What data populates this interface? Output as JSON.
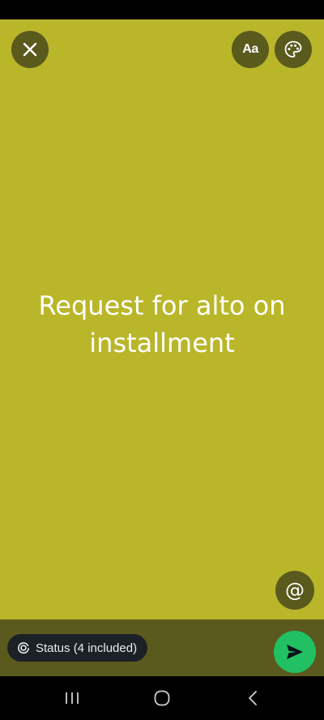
{
  "editor": {
    "status_text": "Request for alto on installment",
    "background_color": "#bab62a",
    "close_icon": "close-icon",
    "font_icon_label": "Aa",
    "palette_icon": "palette-icon",
    "mention_icon_label": "@"
  },
  "bottom": {
    "audience_label": "Status (4 included)",
    "audience_icon": "status-ring-icon",
    "send_icon": "send-icon",
    "send_color": "#21c063"
  },
  "nav": {
    "recents_icon": "recents-icon",
    "home_icon": "home-icon",
    "back_icon": "back-icon"
  }
}
